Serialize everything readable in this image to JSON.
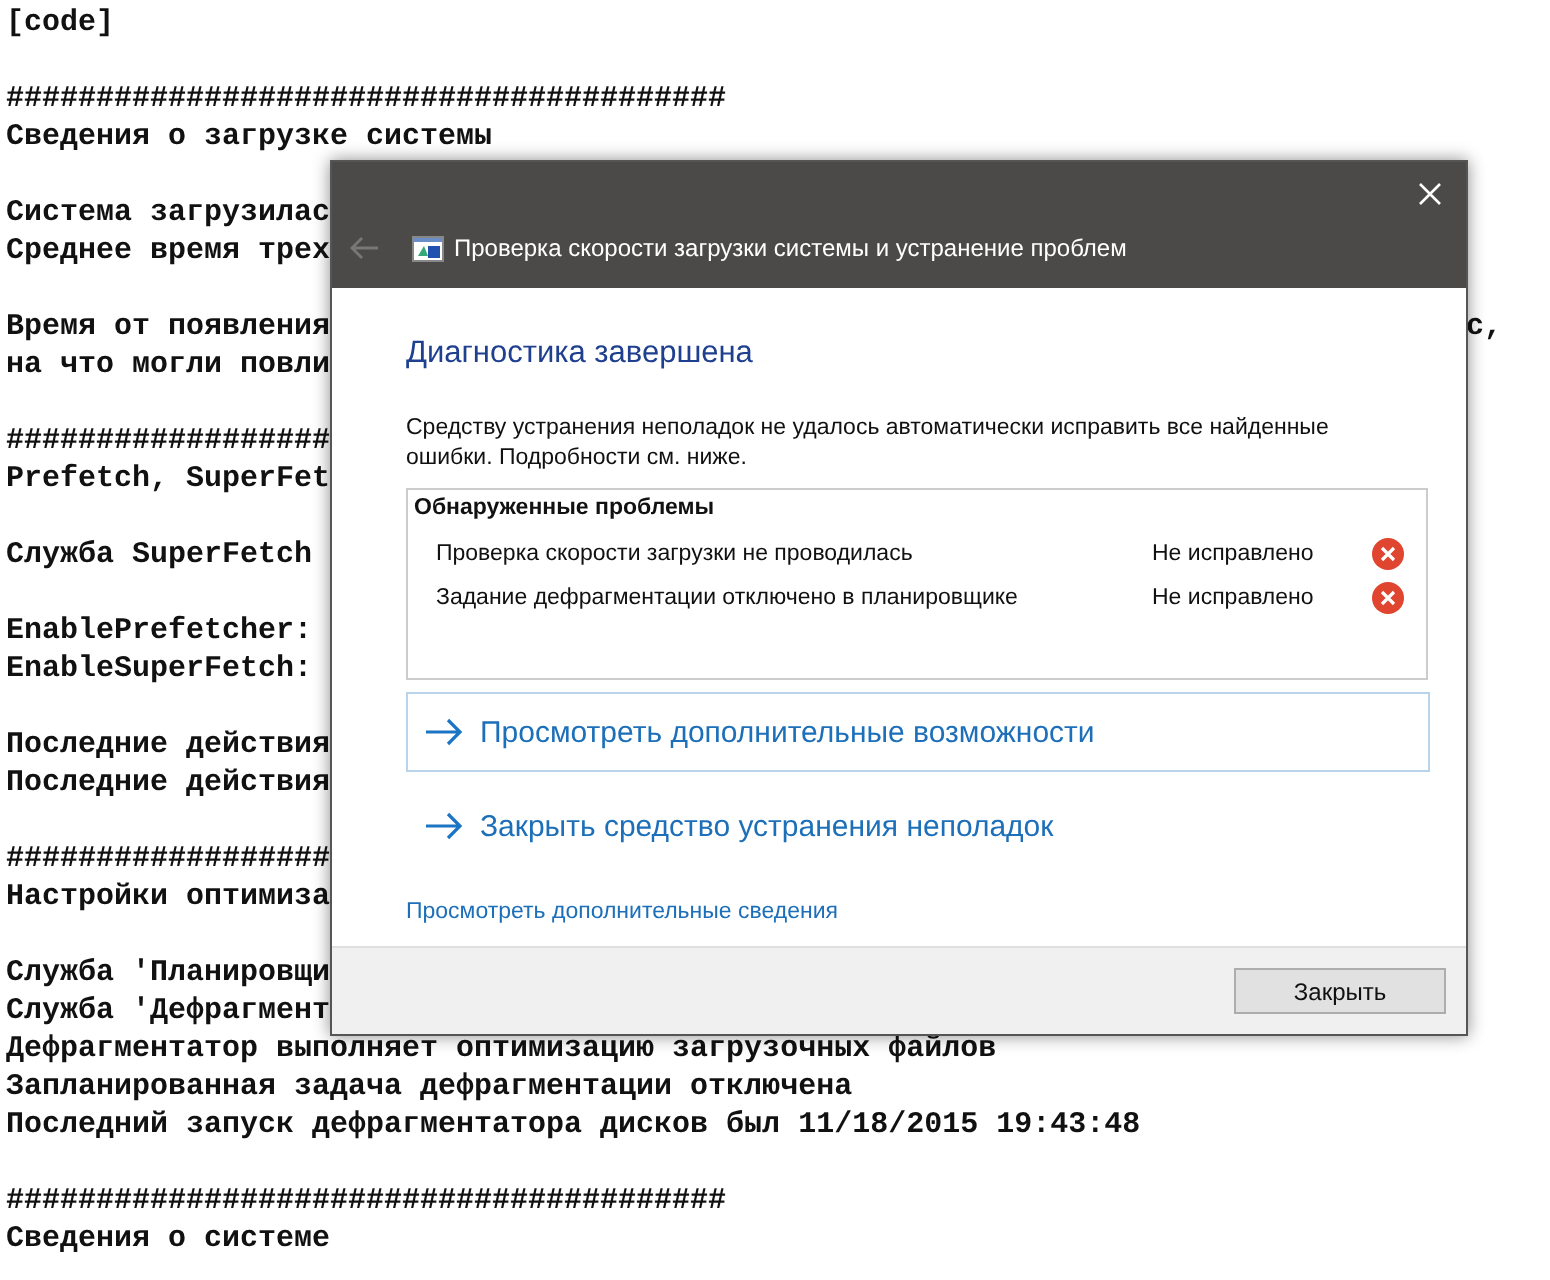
{
  "background_log": {
    "blocks": [
      {
        "lines": [
          {
            "text": "[code]"
          }
        ]
      },
      {
        "lines": [
          {
            "text": "########################################"
          },
          {
            "text": "Сведения о загрузке системы"
          }
        ]
      },
      {
        "lines": [
          {
            "text": "Система загрузилас"
          },
          {
            "text": "Среднее время трех"
          }
        ]
      },
      {
        "lines": [
          {
            "text": "Время от появления",
            "tail": "с,"
          },
          {
            "text": "на что могли повли"
          }
        ]
      },
      {
        "lines": [
          {
            "text": "##################"
          },
          {
            "text": "Prefetch, SuperFet"
          }
        ]
      },
      {
        "lines": [
          {
            "text": "Служба SuperFetch"
          }
        ]
      },
      {
        "lines": [
          {
            "text": "EnablePrefetcher:"
          },
          {
            "text": "EnableSuperFetch:"
          }
        ]
      },
      {
        "lines": [
          {
            "text": "Последние действия"
          },
          {
            "text": "Последние действия"
          }
        ]
      },
      {
        "lines": [
          {
            "text": "##################"
          },
          {
            "text": "Настройки оптимиза"
          }
        ]
      },
      {
        "lines": [
          {
            "text": "Служба 'Планировщи"
          },
          {
            "text": "Служба 'Дефрагмент"
          },
          {
            "text": "Дефрагментатор выполняет оптимизацию загрузочных файлов"
          },
          {
            "text": "Запланированная задача дефрагментации отключена"
          },
          {
            "text": "Последний запуск дефрагментатора дисков был 11/18/2015 19:43:48"
          }
        ]
      },
      {
        "lines": [
          {
            "text": "########################################"
          },
          {
            "text": "Сведения о системе"
          }
        ]
      }
    ]
  },
  "dialog": {
    "title": "Проверка скорости загрузки системы и устранение проблем",
    "back_enabled": false,
    "heading": "Диагностика завершена",
    "message": "Средству устранения неполадок не удалось автоматически исправить все найденные ошибки. Подробности см. ниже.",
    "problems": {
      "title": "Обнаруженные проблемы",
      "rows": [
        {
          "name": "Проверка скорости загрузки не проводилась",
          "status": "Не исправлено",
          "fixed": false
        },
        {
          "name": "Задание дефрагментации отключено в планировщике",
          "status": "Не исправлено",
          "fixed": false
        }
      ]
    },
    "command_links": [
      {
        "label": "Просмотреть дополнительные возможности",
        "selected": true
      },
      {
        "label": "Закрыть средство устранения неполадок",
        "selected": false
      }
    ],
    "details_link": "Просмотреть дополнительные сведения",
    "buttons": [
      "Закрыть"
    ]
  }
}
